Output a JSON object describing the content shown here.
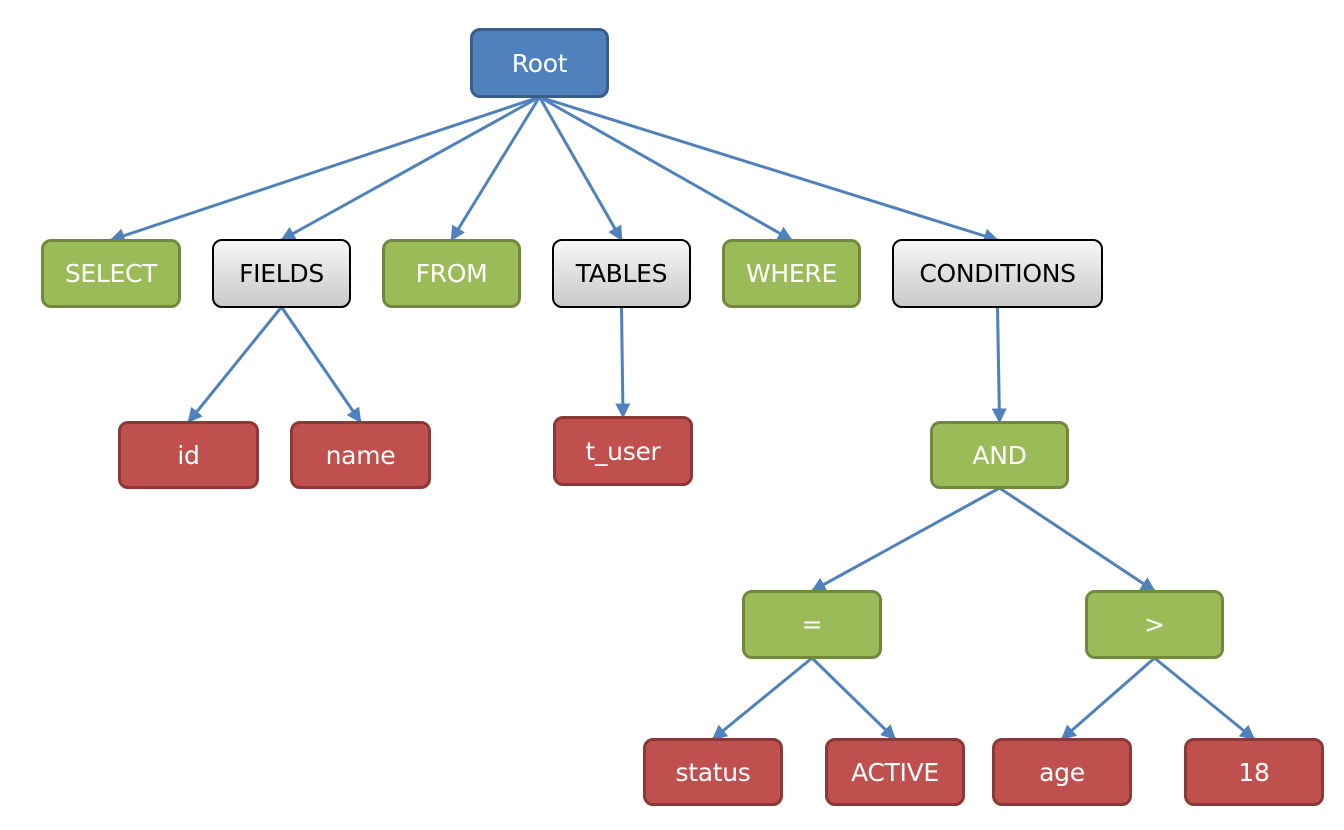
{
  "diagram": {
    "type": "parse-tree",
    "colors": {
      "root": "#4f81bd",
      "keyword": "#9bbb59",
      "clause": "#e0e0e0",
      "leaf": "#c0504d",
      "edge": "#4f81bd"
    },
    "nodes": [
      {
        "id": "root",
        "label": "Root",
        "kind": "blue"
      },
      {
        "id": "select",
        "label": "SELECT",
        "kind": "green"
      },
      {
        "id": "fields",
        "label": "FIELDS",
        "kind": "gray"
      },
      {
        "id": "from",
        "label": "FROM",
        "kind": "green"
      },
      {
        "id": "tables",
        "label": "TABLES",
        "kind": "gray"
      },
      {
        "id": "where",
        "label": "WHERE",
        "kind": "green"
      },
      {
        "id": "conditions",
        "label": "CONDITIONS",
        "kind": "gray"
      },
      {
        "id": "id",
        "label": "id",
        "kind": "red"
      },
      {
        "id": "name",
        "label": "name",
        "kind": "red"
      },
      {
        "id": "t_user",
        "label": "t_user",
        "kind": "red"
      },
      {
        "id": "and",
        "label": "AND",
        "kind": "green"
      },
      {
        "id": "eq",
        "label": "=",
        "kind": "green"
      },
      {
        "id": "gt",
        "label": ">",
        "kind": "green"
      },
      {
        "id": "status",
        "label": "status",
        "kind": "red"
      },
      {
        "id": "active",
        "label": "ACTIVE",
        "kind": "red"
      },
      {
        "id": "age",
        "label": "age",
        "kind": "red"
      },
      {
        "id": "eighteen",
        "label": "18",
        "kind": "red"
      }
    ],
    "edges": [
      {
        "from": "root",
        "to": "select"
      },
      {
        "from": "root",
        "to": "fields"
      },
      {
        "from": "root",
        "to": "from"
      },
      {
        "from": "root",
        "to": "tables"
      },
      {
        "from": "root",
        "to": "where"
      },
      {
        "from": "root",
        "to": "conditions"
      },
      {
        "from": "fields",
        "to": "id"
      },
      {
        "from": "fields",
        "to": "name"
      },
      {
        "from": "tables",
        "to": "t_user"
      },
      {
        "from": "conditions",
        "to": "and"
      },
      {
        "from": "and",
        "to": "eq"
      },
      {
        "from": "and",
        "to": "gt"
      },
      {
        "from": "eq",
        "to": "status"
      },
      {
        "from": "eq",
        "to": "active"
      },
      {
        "from": "gt",
        "to": "age"
      },
      {
        "from": "gt",
        "to": "eighteen"
      }
    ]
  }
}
